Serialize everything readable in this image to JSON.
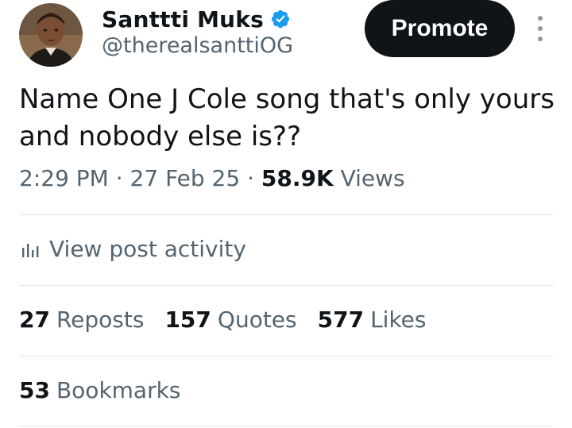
{
  "author": {
    "display_name": "Santtti Muks",
    "handle": "@therealsanttiOG",
    "verified_icon": "verified-badge-icon",
    "avatar": "profile-photo"
  },
  "header": {
    "promote_label": "Promote",
    "more_icon": "more-vertical-icon"
  },
  "post": {
    "text": "Name One J Cole song that's only yours and nobody else is??"
  },
  "meta": {
    "time": "2:29 PM",
    "separator": "·",
    "date": "27 Feb 25",
    "views_count": "58.9K",
    "views_label": "Views"
  },
  "activity": {
    "label": "View post activity",
    "icon": "stats-bar-icon"
  },
  "engagement": {
    "reposts_count": "27",
    "reposts_label": "Reposts",
    "quotes_count": "157",
    "quotes_label": "Quotes",
    "likes_count": "577",
    "likes_label": "Likes",
    "bookmarks_count": "53",
    "bookmarks_label": "Bookmarks"
  },
  "colors": {
    "text_primary": "#0f1419",
    "text_secondary": "#536471",
    "verified_blue": "#1d9bf0",
    "promote_bg": "#0f1419",
    "divider": "#e1e6ea"
  }
}
